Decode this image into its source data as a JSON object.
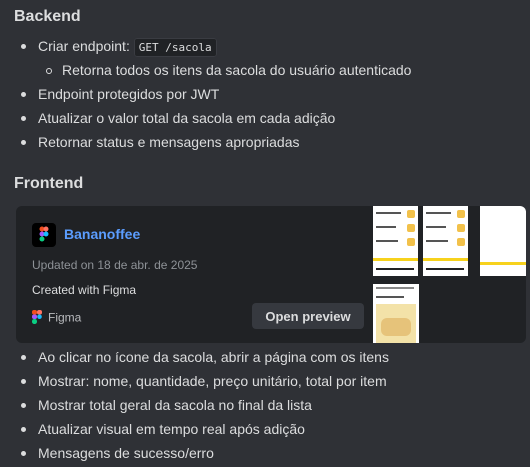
{
  "backend": {
    "heading": "Backend",
    "endpoint_prefix": "Criar endpoint:",
    "endpoint_code": "GET /sacola",
    "sub_item": "Retorna todos os itens da sacola do usuário autenticado",
    "items": [
      "Endpoint protegidos por JWT",
      "Atualizar o valor total da sacola em cada adição",
      "Retornar status e mensagens apropriadas"
    ]
  },
  "frontend": {
    "heading": "Frontend",
    "items": [
      "Ao clicar no ícone da sacola, abrir a página com os itens",
      "Mostrar: nome, quantidade, preço unitário, total por item",
      "Mostrar total geral da sacola no final da lista",
      "Atualizar visual em tempo real após adição",
      "Mensagens de sucesso/erro"
    ]
  },
  "embed": {
    "title": "Bananoffee",
    "updated": "Updated on 18 de abr. de 2025",
    "created": "Created with Figma",
    "source": "Figma",
    "button": "Open preview",
    "accent": "#5b9dff"
  }
}
